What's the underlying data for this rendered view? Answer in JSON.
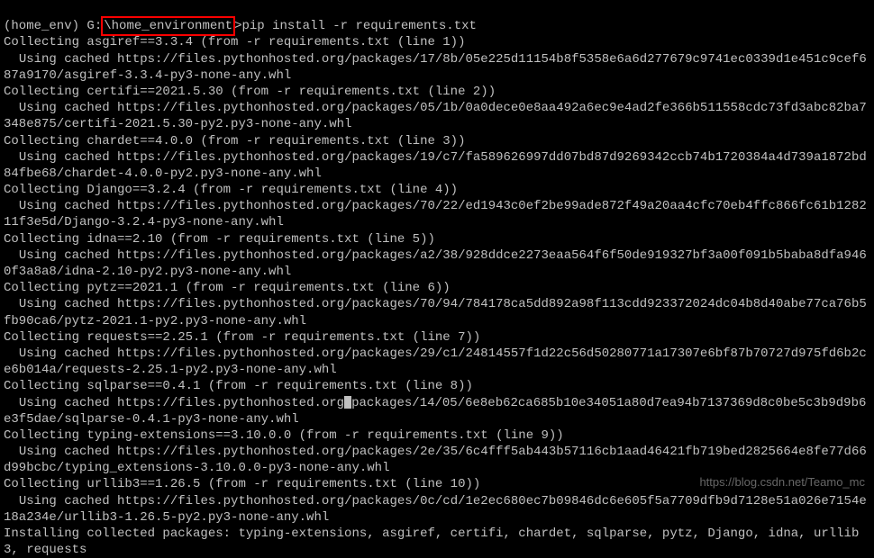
{
  "prompt": {
    "env": "(home_env)",
    "path_prefix": " G:",
    "path_highlighted": "\\home_environment",
    "path_suffix": ">",
    "command": "pip install -r requirements.txt"
  },
  "packages": [
    {
      "collecting": "Collecting asgiref==3.3.4 (from -r requirements.txt (line 1))",
      "cached": "  Using cached https://files.pythonhosted.org/packages/17/8b/05e225d11154b8f5358e6a6d277679c9741ec0339d1e451c9cef687a9170/asgiref-3.3.4-py3-none-any.whl"
    },
    {
      "collecting": "Collecting certifi==2021.5.30 (from -r requirements.txt (line 2))",
      "cached": "  Using cached https://files.pythonhosted.org/packages/05/1b/0a0dece0e8aa492a6ec9e4ad2fe366b511558cdc73fd3abc82ba7348e875/certifi-2021.5.30-py2.py3-none-any.whl"
    },
    {
      "collecting": "Collecting chardet==4.0.0 (from -r requirements.txt (line 3))",
      "cached": "  Using cached https://files.pythonhosted.org/packages/19/c7/fa589626997dd07bd87d9269342ccb74b1720384a4d739a1872bd84fbe68/chardet-4.0.0-py2.py3-none-any.whl"
    },
    {
      "collecting": "Collecting Django==3.2.4 (from -r requirements.txt (line 4))",
      "cached": "  Using cached https://files.pythonhosted.org/packages/70/22/ed1943c0ef2be99ade872f49a20aa4cfc70eb4ffc866fc61b128211f3e5d/Django-3.2.4-py3-none-any.whl"
    },
    {
      "collecting": "Collecting idna==2.10 (from -r requirements.txt (line 5))",
      "cached": "  Using cached https://files.pythonhosted.org/packages/a2/38/928ddce2273eaa564f6f50de919327bf3a00f091b5baba8dfa9460f3a8a8/idna-2.10-py2.py3-none-any.whl"
    },
    {
      "collecting": "Collecting pytz==2021.1 (from -r requirements.txt (line 6))",
      "cached": "  Using cached https://files.pythonhosted.org/packages/70/94/784178ca5dd892a98f113cdd923372024dc04b8d40abe77ca76b5fb90ca6/pytz-2021.1-py2.py3-none-any.whl"
    },
    {
      "collecting": "Collecting requests==2.25.1 (from -r requirements.txt (line 7))",
      "cached": "  Using cached https://files.pythonhosted.org/packages/29/c1/24814557f1d22c56d50280771a17307e6bf87b70727d975fd6b2ce6b014a/requests-2.25.1-py2.py3-none-any.whl"
    },
    {
      "collecting": "Collecting sqlparse==0.4.1 (from -r requirements.txt (line 8))",
      "cached_a": "  Using cached https://files.pythonhosted.org",
      "cached_b": "packages/14/05/6e8eb62ca685b10e34051a80d7ea94b7137369d8c0be5c3b9d9b6e3f5dae/sqlparse-0.4.1-py3-none-any.whl"
    },
    {
      "collecting": "Collecting typing-extensions==3.10.0.0 (from -r requirements.txt (line 9))",
      "cached": "  Using cached https://files.pythonhosted.org/packages/2e/35/6c4fff5ab443b57116cb1aad46421fb719bed2825664e8fe77d66d99bcbc/typing_extensions-3.10.0.0-py3-none-any.whl"
    },
    {
      "collecting": "Collecting urllib3==1.26.5 (from -r requirements.txt (line 10))",
      "cached": "  Using cached https://files.pythonhosted.org/packages/0c/cd/1e2ec680ec7b09846dc6e605f5a7709dfb9d7128e51a026e7154e18a234e/urllib3-1.26.5-py2.py3-none-any.whl"
    }
  ],
  "installing": "Installing collected packages: typing-extensions, asgiref, certifi, chardet, sqlparse, pytz, Django, idna, urllib3, requests",
  "watermark": "https://blog.csdn.net/Teamo_mc"
}
